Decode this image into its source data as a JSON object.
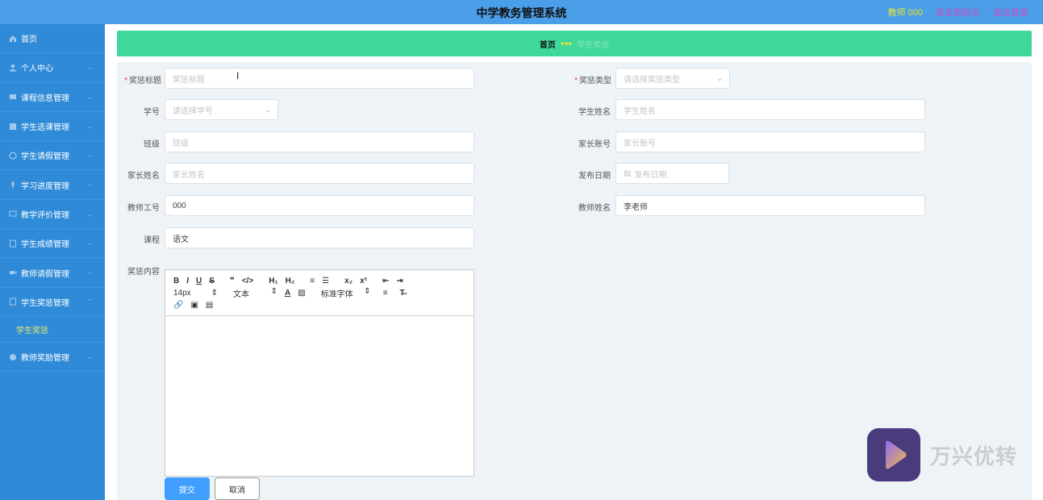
{
  "header": {
    "title": "中学教务管理系统",
    "user": "教师 000",
    "back_link": "退出到前台",
    "logout_link": "退出登录"
  },
  "sidebar": {
    "items": [
      {
        "label": "首页",
        "icon": "home-icon"
      },
      {
        "label": "个人中心",
        "icon": "user-icon"
      },
      {
        "label": "课程信息管理",
        "icon": "grid-icon"
      },
      {
        "label": "学生选课管理",
        "icon": "grid-icon"
      },
      {
        "label": "学生请假管理",
        "icon": "clock-icon"
      },
      {
        "label": "学习进度管理",
        "icon": "mic-icon"
      },
      {
        "label": "教学评价管理",
        "icon": "doc-icon"
      },
      {
        "label": "学生成绩管理",
        "icon": "doc-icon"
      },
      {
        "label": "教师请假管理",
        "icon": "video-icon"
      },
      {
        "label": "学生奖惩管理",
        "icon": "doc-icon"
      },
      {
        "label": "教师奖励管理",
        "icon": "globe-icon"
      }
    ],
    "active_sub": "学生奖惩"
  },
  "breadcrumb": {
    "home": "首页",
    "separator": "♥♥♥",
    "current": "学生奖惩"
  },
  "form": {
    "reward_title": {
      "label": "奖惩标题",
      "placeholder": "奖惩标题"
    },
    "reward_type": {
      "label": "奖惩类型",
      "placeholder": "请选择奖惩类型"
    },
    "student_no": {
      "label": "学号",
      "placeholder": "请选择学号"
    },
    "student_name": {
      "label": "学生姓名",
      "placeholder": "学生姓名"
    },
    "class": {
      "label": "班级",
      "placeholder": "班级"
    },
    "parent_account": {
      "label": "家长账号",
      "placeholder": "家长账号"
    },
    "parent_name": {
      "label": "家长姓名",
      "placeholder": "家长姓名"
    },
    "publish_date": {
      "label": "发布日期",
      "placeholder": "发布日期"
    },
    "teacher_no": {
      "label": "教师工号",
      "value": "000"
    },
    "teacher_name": {
      "label": "教师姓名",
      "value": "李老师"
    },
    "course": {
      "label": "课程",
      "value": "语文"
    },
    "content": {
      "label": "奖惩内容"
    }
  },
  "editor": {
    "font_size": "14px",
    "text_style": "文本",
    "font_family": "标准字体",
    "buttons": [
      "B",
      "I",
      "U",
      "S",
      "❞",
      "</>",
      "H₁",
      "H₂",
      "≡",
      "☰",
      "x₂",
      "x²",
      "⇤",
      "⇥"
    ]
  },
  "actions": {
    "submit": "提交",
    "cancel": "取消"
  },
  "watermark": {
    "text": "万兴优转"
  },
  "colors": {
    "topbar": "#4a9fe8",
    "sidebar": "#2f8bd8",
    "breadcrumb": "#3fd89a",
    "primary": "#409eff"
  }
}
